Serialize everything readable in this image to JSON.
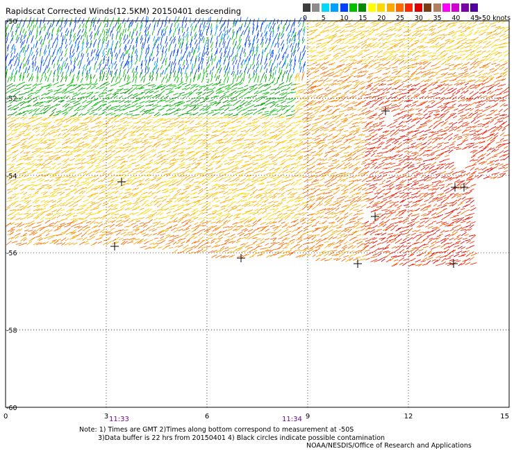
{
  "title": "Rapidscat Corrected Winds(12.5KM) 20150401 descending",
  "legend": {
    "unit_label": ">50 knots",
    "ticks": [
      "0",
      "5",
      "10",
      "15",
      "20",
      "25",
      "30",
      "35",
      "40",
      "45"
    ],
    "colors": [
      "#3c3c3c",
      "#8c8c8c",
      "#00d8ff",
      "#00a0ff",
      "#0040ff",
      "#00c000",
      "#008c00",
      "#ffff00",
      "#ffd800",
      "#ffa800",
      "#ff6800",
      "#ff2800",
      "#e00000",
      "#7a3c10",
      "#b08060",
      "#ff00ff",
      "#d000d0",
      "#7a00a8",
      "#5000a0"
    ]
  },
  "map": {
    "lat_labels": [
      "-50",
      "-52",
      "-54",
      "-56",
      "-58",
      "-60"
    ],
    "lon_labels": [
      "0",
      "3",
      "6",
      "9",
      "12",
      "15"
    ],
    "time_labels": [
      "11:33",
      "11:34"
    ]
  },
  "notes": {
    "line1": "Note: 1) Times are GMT 2)Times along bottom correspond to measurement at -50S",
    "line2": "3)Data buffer is 22 hrs from 20150401 4) Black circles indicate possible contamination",
    "credit": "NOAA/NESDIS/Office of Research and Applications"
  }
}
